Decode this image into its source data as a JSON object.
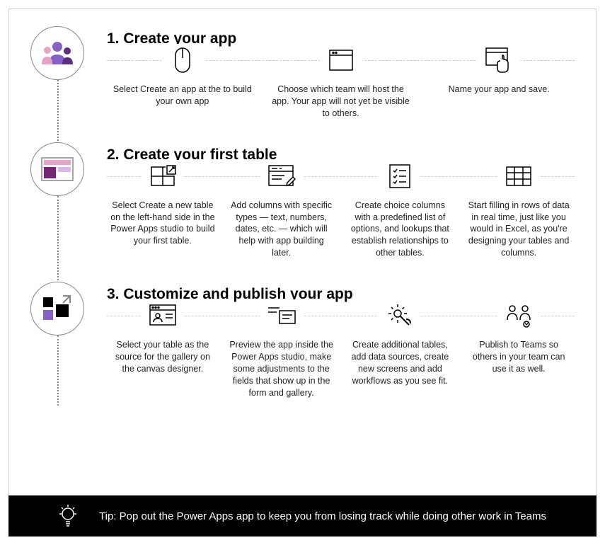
{
  "steps": [
    {
      "title": "1. Create your app",
      "subs": [
        "Select Create an app at the to build your own app",
        "Choose which team will host the app. Your app will not yet be visible to others.",
        "Name your app and save."
      ]
    },
    {
      "title": "2. Create your first table",
      "subs": [
        "Select Create a new table on the left-hand side in the Power Apps studio to build your first table.",
        "Add columns with specific types — text, numbers, dates, etc. — which will help with app building later.",
        "Create choice columns with a predefined list of options, and lookups that establish relationships to other tables.",
        "Start filling in rows of data in real time, just like you would in Excel, as you're designing your tables and columns."
      ]
    },
    {
      "title": "3. Customize and publish your app",
      "subs": [
        "Select your table as the source for the gallery on the canvas designer.",
        "Preview the app inside the Power Apps studio, make some adjustments to the fields that show up in the form and gallery.",
        "Create additional tables, add data sources, create new screens and add workflows as you see fit.",
        "Publish to Teams so others in your team can use it as well."
      ]
    }
  ],
  "tip": "Tip: Pop out the Power Apps app to keep you from losing track while doing other work in Teams"
}
